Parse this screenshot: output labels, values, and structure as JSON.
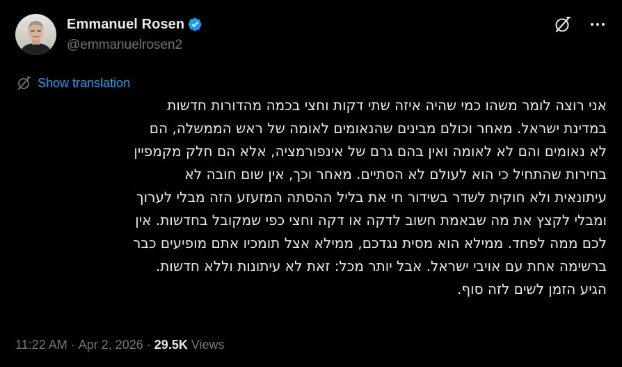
{
  "author": {
    "display_name": "Emmanuel Rosen",
    "handle": "@emmanuelrosen2",
    "verified": true,
    "avatar_icon": "profile-photo"
  },
  "actions": {
    "grok_icon": "grok-icon",
    "more_icon": "more-horizontal-icon"
  },
  "translation": {
    "label": "Show translation",
    "icon": "translate-icon"
  },
  "body": {
    "lines": [
      "אני רוצה לומר משהו כמי שהיה איזה שתי דקות וחצי בכמה מהדורות חדשות",
      "במדינת ישראל. מאחר וכולם מבינים שהנאומים לאומה של ראש הממשלה, הם",
      "לא נאומים והם לא לאומה ואין בהם גרם של אינפורמציה, אלא הם חלק מקמפיין",
      "בחירות שהתחיל כי הוא לעולם לא הסתיים. מאחר וכך, אין שום חובה לא",
      "עיתונאית ולא חוקית לשדר בשידור חי את בליל ההסתה המזעזע הזה מבלי לערוך",
      "ומבלי לקצץ את מה שבאמת חשוב לדקה או דקה וחצי כפי שמקובל בחדשות. אין",
      "לכם ממה לפחד. ממילא הוא מסית נגדכם, ממילא אצל תומכיו אתם מופיעים כבר",
      "ברשימה אחת עם אויבי ישראל. אבל יותר מכל: זאת לא עיתונות וללא חדשות.",
      "הגיע הזמן לשים לזה סוף."
    ]
  },
  "meta": {
    "time": "11:22 AM",
    "separator": "·",
    "date": "Apr 2, 2026",
    "views_count": "29.5K",
    "views_label": "Views"
  },
  "colors": {
    "background": "#000000",
    "text": "#e7e9ea",
    "secondary": "#71767b",
    "link": "#1d9bf0",
    "verified": "#1d9bf0"
  }
}
